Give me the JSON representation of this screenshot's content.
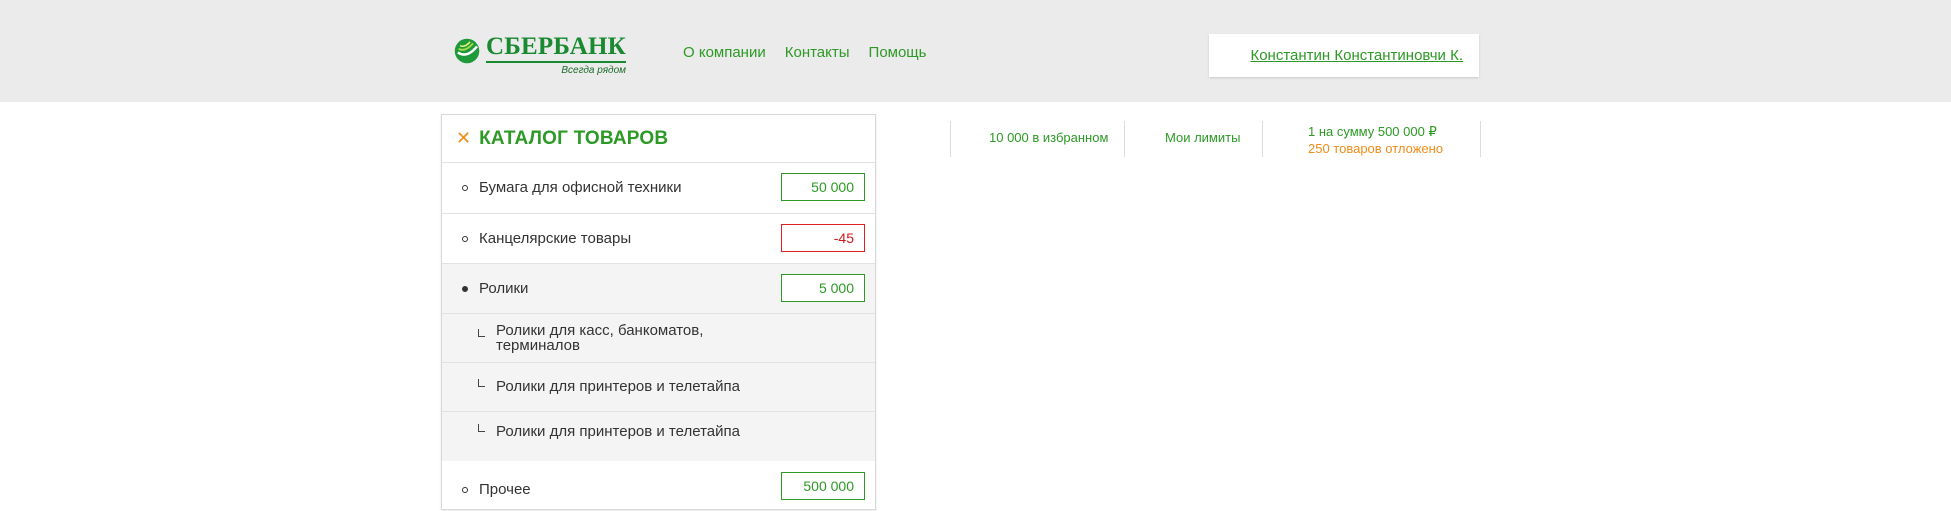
{
  "header": {
    "logo": {
      "name": "СБЕРБАНК",
      "slogan": "Всегда рядом"
    },
    "nav": [
      "О компании",
      "Контакты",
      "Помощь"
    ],
    "user": "Константин Константиновчи К."
  },
  "catalog": {
    "title": "КАТАЛОГ ТОВАРОВ",
    "rows": [
      {
        "label": "Бумага для офисной техники",
        "qty": "50 000"
      },
      {
        "label": "Канцелярские товары",
        "qty": "-45"
      },
      {
        "label": "Ролики",
        "qty": "5 000"
      }
    ],
    "subitems": [
      "Ролики для касс, банкоматов, терминалов",
      "Ролики для принтеров и телетайпа",
      "Ролики для принтеров и телетайпа"
    ],
    "last_row": {
      "label": "Прочее",
      "qty": "500 000"
    }
  },
  "stats": {
    "favorites": "10 000 в избранном",
    "limits": "Мои лимиты",
    "sum": "1 на сумму 500 000 ₽",
    "deferred": "250 товаров отложено"
  },
  "colors": {
    "brand_green": "#2c9a24",
    "accent_orange": "#f08c1a",
    "error_red": "#e02020",
    "header_bg": "#ebebeb"
  }
}
